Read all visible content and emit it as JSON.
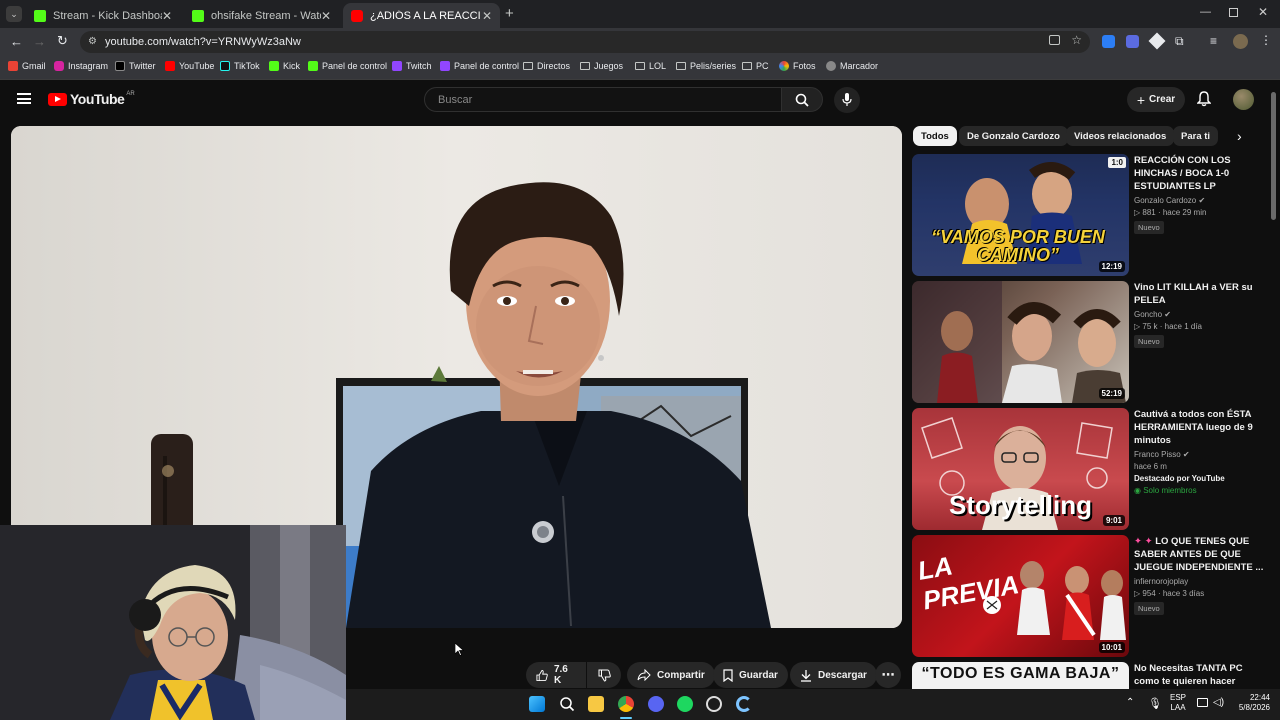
{
  "tabs": [
    {
      "title": "Stream - Kick Dashboard",
      "color": "#53fc18"
    },
    {
      "title": "ohsifake Stream - Watch Live o",
      "color": "#53fc18"
    },
    {
      "title": "¿ADIÓS A LA REACCIÓN CON",
      "color": "#ff0000"
    }
  ],
  "url": "youtube.com/watch?v=YRNWyWz3aNw",
  "bookmarks": [
    "Gmail",
    "Instagram",
    "Twitter",
    "YouTube",
    "TikTok",
    "Kick",
    "Panel de control",
    "Twitch",
    "Panel de control",
    "Directos",
    "Juegos",
    "LOL",
    "Pelis/series",
    "PC",
    "Fotos",
    "Marcador"
  ],
  "yt": {
    "logo": "YouTube",
    "region": "AR",
    "search_placeholder": "Buscar",
    "create_label": "Crear"
  },
  "actions": {
    "likes": "7.6 K",
    "share": "Compartir",
    "save": "Guardar",
    "download": "Descargar"
  },
  "chips": [
    "Todos",
    "De Gonzalo Cardozo",
    "Videos relacionados",
    "Para ti"
  ],
  "videos": [
    {
      "title": "REACCIÓN CON LOS HINCHAS / BOCA 1-0 ESTUDIANTES LP",
      "channel": "Gonzalo Cardozo",
      "views": "881",
      "age": "hace 29 min",
      "badge": "Nuevo",
      "duration": "12:19",
      "thumb_text": "“VAMOS POR BUEN CAMINO”",
      "score": "1:0"
    },
    {
      "title": "Vino LIT KILLAH a VER su PELEA",
      "channel": "Goncho",
      "views": "75 k",
      "age": "hace 1 día",
      "badge": "Nuevo",
      "duration": "52:19"
    },
    {
      "title": "Cautivá a todos con ÉSTA HERRAMIENTA luego de 9 minutos",
      "channel": "Franco Pisso",
      "age": "hace 6 m",
      "featured": "Destacado por YouTube",
      "members": "Solo miembros",
      "duration": "9:01",
      "thumb_text": "Storytelling"
    },
    {
      "title": "LO QUE TENES QUE SABER ANTES DE QUE JUEGUE INDEPENDIENTE ...",
      "channel": "infiernorojoplay",
      "views": "954",
      "age": "hace 3 días",
      "badge": "Nuevo",
      "duration": "10:01",
      "thumb_text": "LA PREVIA"
    },
    {
      "title": "No Necesitas TANTA PC como te quieren hacer CREER",
      "thumb_text": "“TODO ES GAMA BAJA”"
    }
  ],
  "tray": {
    "lang": "ESP",
    "layout": "LAA",
    "time": "22:44",
    "date": "5/8/2026"
  }
}
